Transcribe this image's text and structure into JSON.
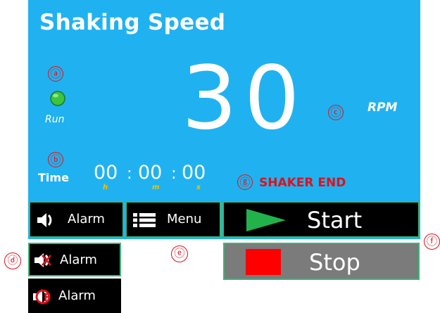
{
  "panel": {
    "title": "Shaking Speed",
    "run_label": "Run",
    "speed_value": "30",
    "speed_unit": "RPM",
    "time_label": "Time",
    "time": {
      "hours": "00",
      "minutes": "00",
      "seconds": "00",
      "sep": ":",
      "h_unit": "h",
      "m_unit": "m",
      "s_unit": "s"
    },
    "status_message": "SHAKER END"
  },
  "markers": {
    "a": "ⓐ",
    "b": "ⓑ",
    "c": "ⓒ",
    "d": "ⓓ",
    "e": "ⓔ",
    "f": "ⓕ",
    "g": "ⓖ"
  },
  "buttons": {
    "alarm_label": "Alarm",
    "menu_label": "Menu",
    "start_label": "Start",
    "stop_label": "Stop",
    "alarm_mute_label": "Alarm",
    "alarm_off_label": "Alarm"
  },
  "colors": {
    "panel_bg": "#20b2f0",
    "led": "#3ec43e",
    "start_triangle": "#22b24c",
    "stop_square": "#ff0000",
    "annotation": "#e0101a",
    "button_border": "#3bb57a"
  },
  "icons": {
    "run_led": "green-led-icon",
    "alarm": "speaker-icon",
    "menu": "list-menu-icon",
    "start": "play-icon",
    "stop": "stop-square-icon",
    "alarm_mute": "speaker-muted-icon",
    "alarm_off": "speaker-off-icon"
  }
}
